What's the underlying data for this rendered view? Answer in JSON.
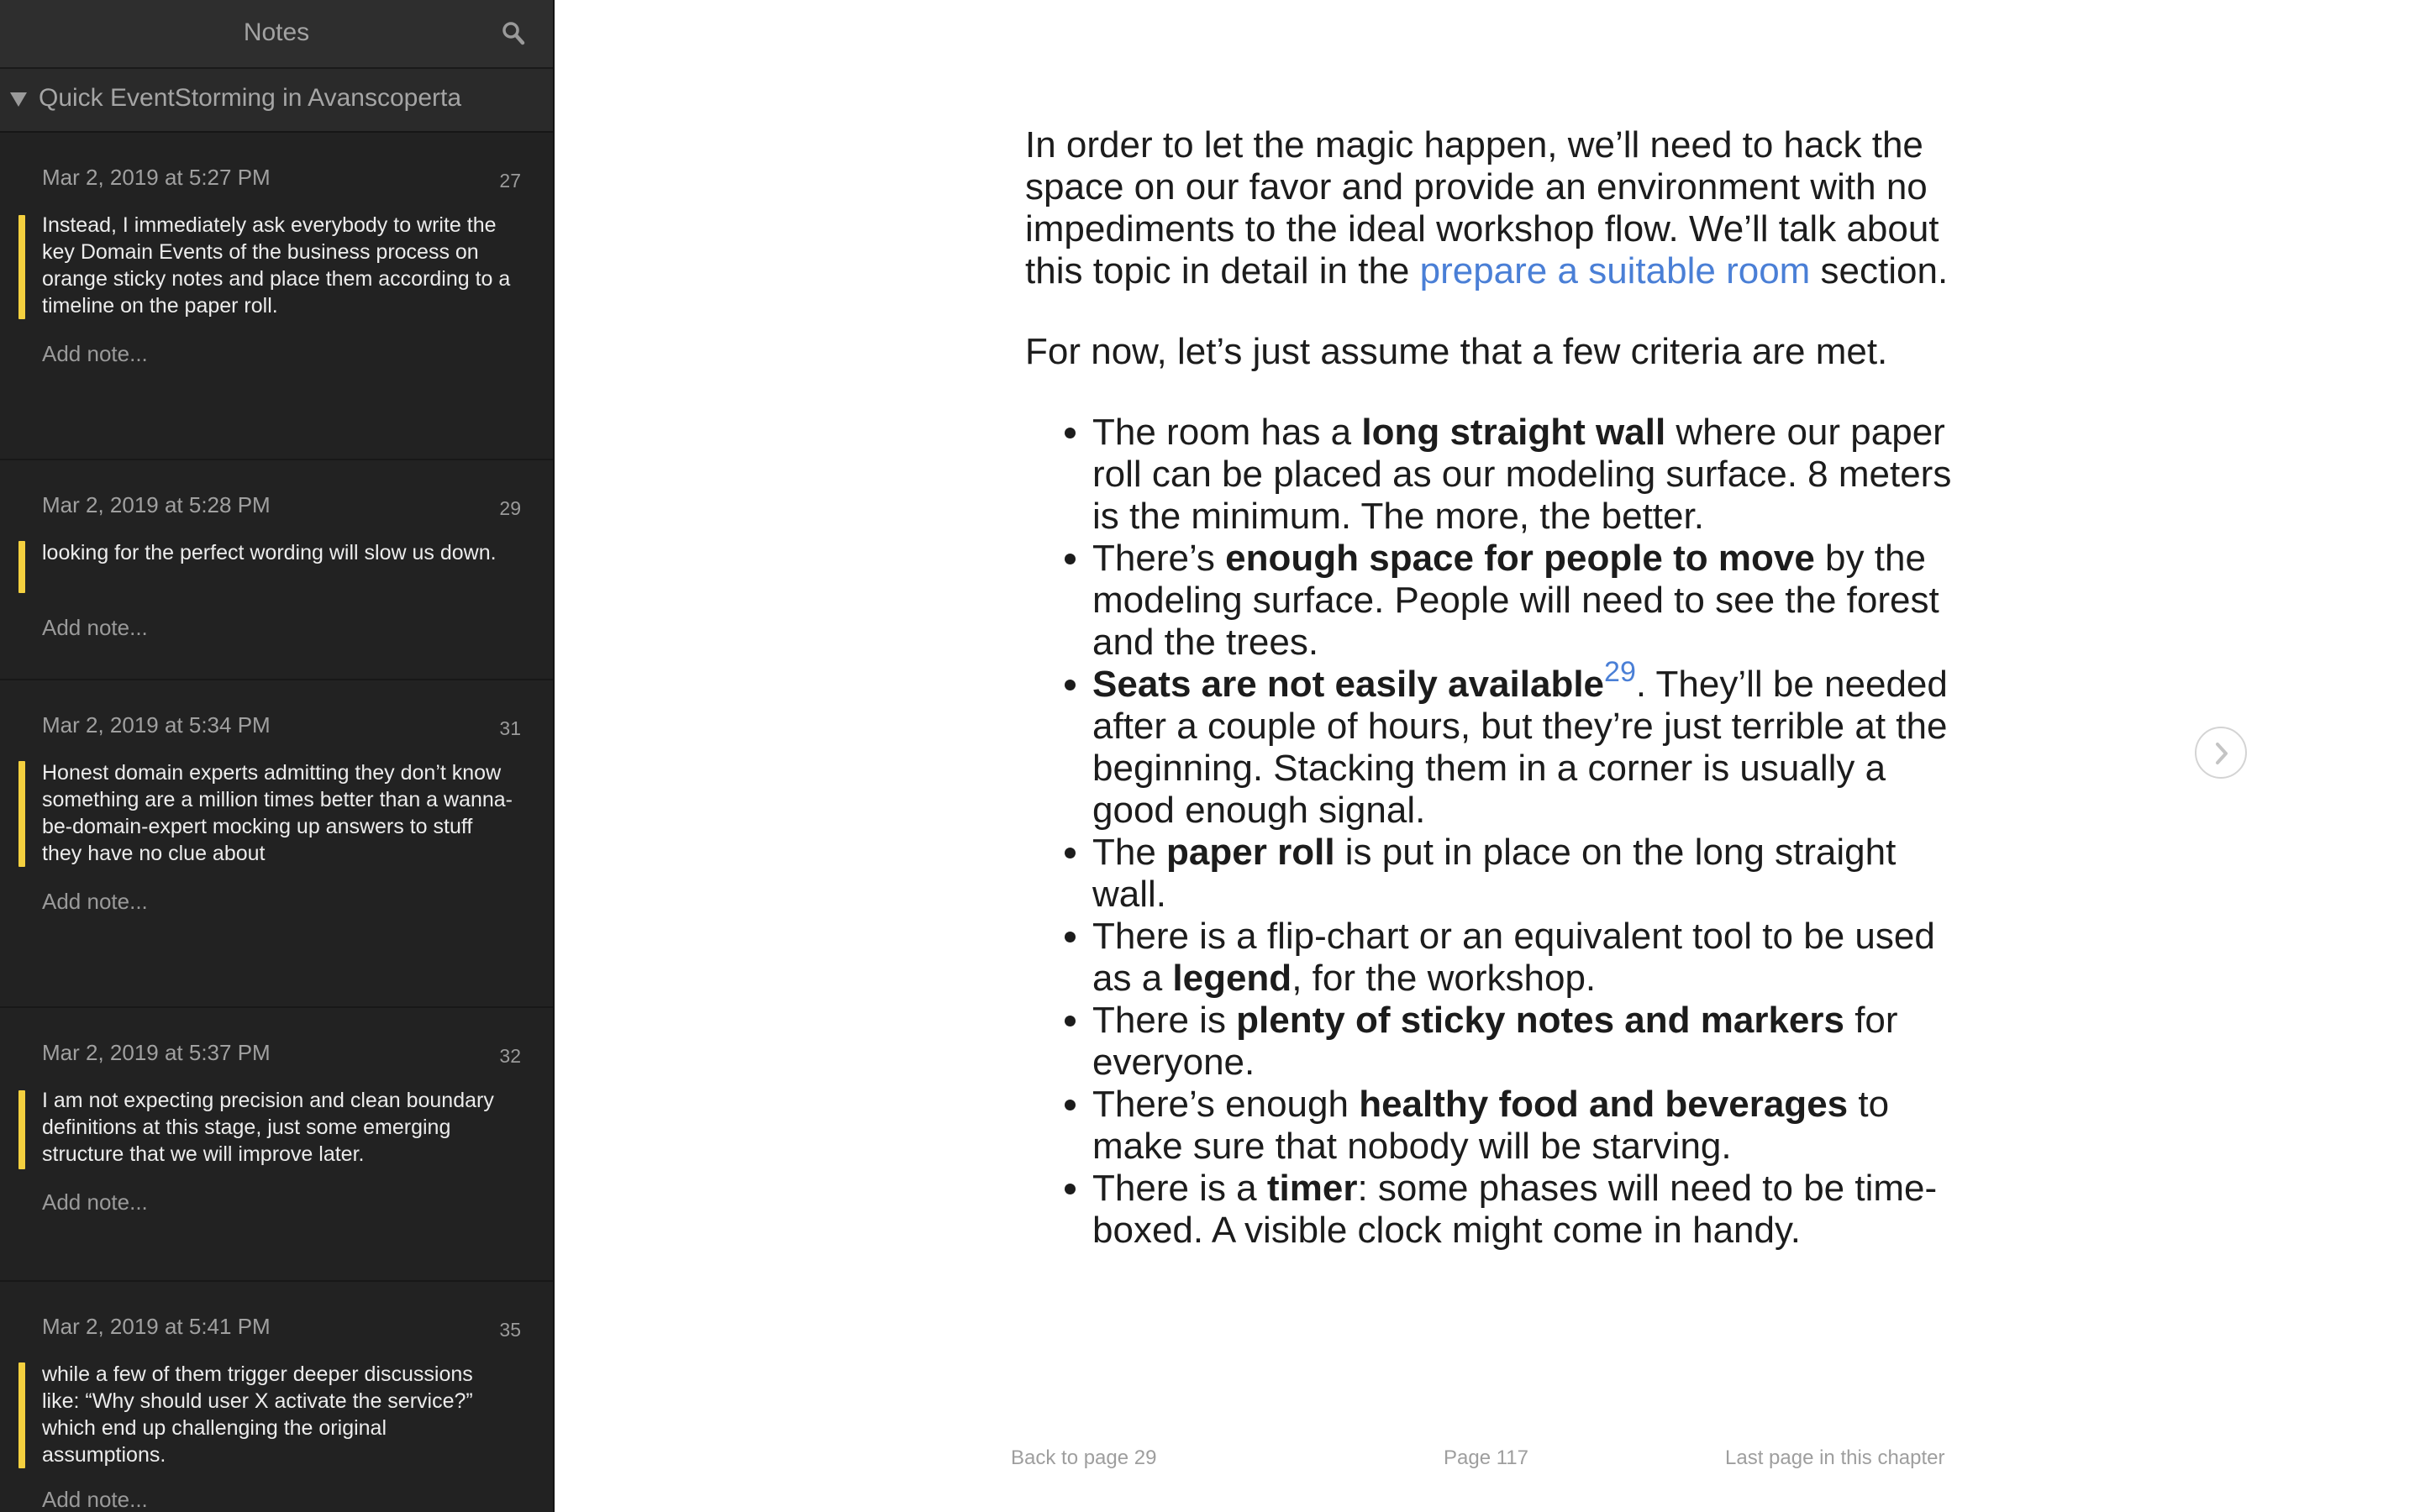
{
  "sidebar": {
    "title": "Notes",
    "search_icon": "search-icon",
    "chapter": "Quick EventStorming in Avanscoperta",
    "notes": [
      {
        "date": "Mar 2, 2019 at 5:27 PM",
        "page": "27",
        "text": "Instead, I immediately ask everybody to write the key Domain Events of the business process on orange sticky notes and place them according to a timeline on the paper roll.",
        "add": "Add note..."
      },
      {
        "date": "Mar 2, 2019 at 5:28 PM",
        "page": "29",
        "text": "looking for the perfect wording will slow us down.",
        "add": "Add note..."
      },
      {
        "date": "Mar 2, 2019 at 5:34 PM",
        "page": "31",
        "text": "Honest domain experts admitting they don’t know something are a million times better than a wanna-be-domain-expert mocking up answers to stuff they have no clue about",
        "add": "Add note..."
      },
      {
        "date": "Mar 2, 2019 at 5:37 PM",
        "page": "32",
        "text": "I am not expecting precision and clean boundary definitions at this stage, just some emerging structure that we will improve later.",
        "add": "Add note..."
      },
      {
        "date": "Mar 2, 2019 at 5:41 PM",
        "page": "35",
        "text": "while a few of them trigger deeper discussions like: “Why should user X activate the service?” which end up challenging the original assumptions.",
        "add": "Add note..."
      }
    ],
    "highlight_color": "#f4d03f"
  },
  "reader": {
    "p1": {
      "before": "In order to let the magic happen, we’ll need to hack the space on our favor and provide an environment with no impediments to the ideal workshop flow. We’ll talk about this topic in detail in the ",
      "link": "prepare a suitable room",
      "after": " section."
    },
    "p2": "For now, let’s just assume that a few criteria are met.",
    "bullets": [
      {
        "pre": "The room has a ",
        "bold": "long straight wall",
        "post": " where our paper roll can be placed as our modeling surface. 8 meters is the minimum. The more, the better."
      },
      {
        "pre": "There’s ",
        "bold": "enough space for people to move",
        "post": " by the modeling surface. People will need to see the forest and the trees."
      },
      {
        "pre": "",
        "bold": "Seats are not easily available",
        "sup": "29",
        "post": ". They’ll be needed after a couple of hours, but they’re just terrible at the beginning. Stacking them in a corner is usually a good enough signal."
      },
      {
        "pre": "The ",
        "bold": "paper roll",
        "post": " is put in place on the long straight wall."
      },
      {
        "pre": "There is a flip-chart or an equivalent tool to be used as a ",
        "bold": "legend",
        "post": ", for the workshop."
      },
      {
        "pre": "There is ",
        "bold": "plenty of sticky notes and markers",
        "post": " for everyone."
      },
      {
        "pre": "There’s enough ",
        "bold": "healthy food and beverages",
        "post": " to make sure that nobody will be starving."
      },
      {
        "pre": "There is a ",
        "bold": "timer",
        "post": ": some phases will need to be time-boxed. A visible clock might come in handy."
      }
    ],
    "next_icon": "chevron-right-icon",
    "link_color": "#4a7fd6",
    "footer": {
      "back": "Back to page 29",
      "page": "Page 117",
      "chapter": "Last page in this chapter"
    }
  }
}
